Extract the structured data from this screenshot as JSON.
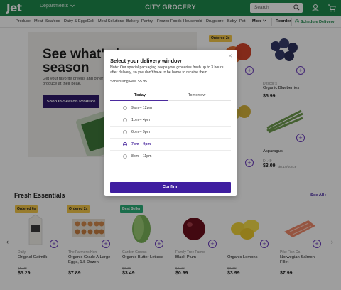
{
  "header": {
    "logo": "Jet",
    "departments_label": "Departments",
    "store_name": "CITY GROCERY",
    "search_placeholder": "Search",
    "brand_color": "#1e8a4c"
  },
  "nav": {
    "items": [
      "Produce",
      "Meat",
      "Seafood",
      "Dairy & Eggs",
      "Deli",
      "Meal Solutions",
      "Bakery",
      "Pantry",
      "Frozen Foods",
      "Household",
      "Drugstore",
      "Baby",
      "Pet"
    ],
    "more_label": "More",
    "reorder_label": "Reorder",
    "schedule_label": "Schedule Delivery"
  },
  "hero": {
    "title": "See what's in season",
    "subtitle": "Get your favorite greens and other produce at their peak.",
    "cta_label": "Shop In-Season Produce"
  },
  "top_right_products": [
    {
      "badge": "Ordered 2x",
      "brand": "",
      "name": "",
      "price": "",
      "was_price": ""
    },
    {
      "badge": "",
      "brand": "Driscoll's",
      "name": "Organic Blueberries",
      "price": "$5.99",
      "was_price": ""
    },
    {
      "badge": "",
      "brand": "",
      "name": "",
      "price": "",
      "was_price": ""
    },
    {
      "badge": "",
      "brand": "",
      "name": "Asparagus",
      "price": "$3.09",
      "was_price": "$4.49",
      "unit": "$0.19/ounce"
    }
  ],
  "fresh": {
    "title": "Fresh Essentials",
    "see_all_label": "See All",
    "products": [
      {
        "badge": "Ordered 6x",
        "badge_type": "yellow",
        "brand": "Daily",
        "name": "Original Oatmilk",
        "was_price": "$5.99",
        "price": "$5.29"
      },
      {
        "badge": "Ordered 2x",
        "badge_type": "yellow",
        "brand": "The Farmer's Hen",
        "name": "Organic Grade A Large Eggs, 1.5 Dozen",
        "was_price": "",
        "price": "$7.89"
      },
      {
        "badge": "Best Seller",
        "badge_type": "green",
        "brand": "Garden Greens",
        "name": "Organic Butter Lettuce",
        "was_price": "$4.49",
        "price": "$3.49"
      },
      {
        "badge": "",
        "badge_type": "",
        "brand": "Family Tree Farms",
        "name": "Black Plum",
        "was_price": "$1.29",
        "price": "$0.99"
      },
      {
        "badge": "",
        "badge_type": "",
        "brand": "",
        "name": "Organic Lemons",
        "was_price": "$4.49",
        "price": "$3.99"
      },
      {
        "badge": "",
        "badge_type": "",
        "brand": "Pike Fish Co.",
        "name": "Norwegian Salmon Fillet",
        "was_price": "",
        "price": "$7.99"
      }
    ]
  },
  "modal": {
    "title": "Select your delivery window",
    "note": "Note: Our special packaging keeps your groceries fresh up to 3 hours after delivery, so you don't have to be home to receive them.",
    "fee": "Scheduling Fee: $5.95",
    "tabs": [
      "Today",
      "Tomorrow"
    ],
    "active_tab": "Today",
    "slots": [
      {
        "label": "9am – 12pm",
        "selected": false
      },
      {
        "label": "1pm – 4pm",
        "selected": false
      },
      {
        "label": "6pm – 9pm",
        "selected": false
      },
      {
        "label": "7pm – 9pm",
        "selected": true
      },
      {
        "label": "8pm – 11pm",
        "selected": false
      }
    ],
    "confirm_label": "Confirm",
    "accent_color": "#3f1ea0"
  }
}
